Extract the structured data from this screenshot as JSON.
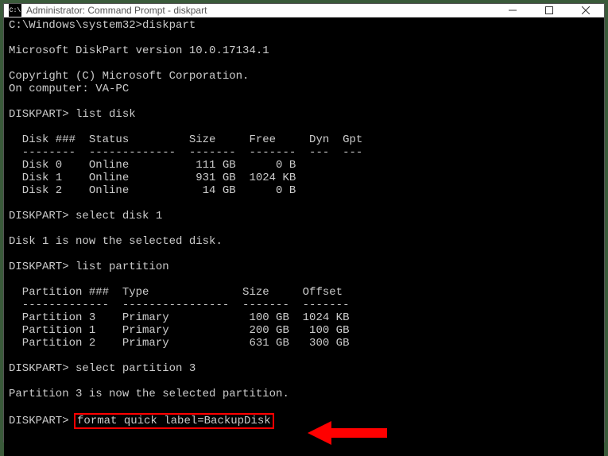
{
  "titlebar": {
    "icon_label": "C:\\",
    "title": "Administrator: Command Prompt - diskpart"
  },
  "win_buttons": {
    "minimize": "minimize",
    "maximize": "maximize",
    "close": "close"
  },
  "terminal": {
    "prompt_path": "C:\\Windows\\system32>",
    "cmd_diskpart": "diskpart",
    "blank": "",
    "version_line": "Microsoft DiskPart version 10.0.17134.1",
    "copyright_line": "Copyright (C) Microsoft Corporation.",
    "computer_line": "On computer: VA-PC",
    "dp_prompt": "DISKPART> ",
    "cmd_list_disk": "list disk",
    "disk_header": "  Disk ###  Status         Size     Free     Dyn  Gpt",
    "disk_divider": "  --------  -------------  -------  -------  ---  ---",
    "disk_row0": "  Disk 0    Online          111 GB      0 B",
    "disk_row1": "  Disk 1    Online          931 GB  1024 KB",
    "disk_row2": "  Disk 2    Online           14 GB      0 B",
    "cmd_select_disk": "select disk 1",
    "select_disk_result": "Disk 1 is now the selected disk.",
    "cmd_list_partition": "list partition",
    "part_header": "  Partition ###  Type              Size     Offset",
    "part_divider": "  -------------  ----------------  -------  -------",
    "part_row0": "  Partition 3    Primary            100 GB  1024 KB",
    "part_row1": "  Partition 1    Primary            200 GB   100 GB",
    "part_row2": "  Partition 2    Primary            631 GB   300 GB",
    "cmd_select_partition": "select partition 3",
    "select_part_result": "Partition 3 is now the selected partition.",
    "cmd_format": "format quick label=BackupDisk"
  }
}
